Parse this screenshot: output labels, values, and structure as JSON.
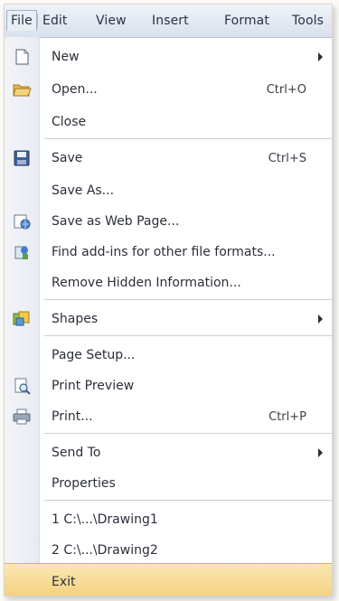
{
  "menubar": {
    "items": [
      {
        "label": "File"
      },
      {
        "label": "Edit"
      },
      {
        "label": "View"
      },
      {
        "label": "Insert"
      },
      {
        "label": "Format"
      },
      {
        "label": "Tools"
      }
    ]
  },
  "file_menu": {
    "items": [
      {
        "label": "New",
        "shortcut": "",
        "submenu": true,
        "icon": "new-document-icon"
      },
      {
        "label": "Open...",
        "shortcut": "Ctrl+O",
        "submenu": false,
        "icon": "open-folder-icon"
      },
      {
        "label": "Close",
        "shortcut": "",
        "submenu": false,
        "icon": ""
      },
      {
        "label": "Save",
        "shortcut": "Ctrl+S",
        "submenu": false,
        "icon": "save-disk-icon"
      },
      {
        "label": "Save As...",
        "shortcut": "",
        "submenu": false,
        "icon": ""
      },
      {
        "label": "Save as Web Page...",
        "shortcut": "",
        "submenu": false,
        "icon": "web-page-icon"
      },
      {
        "label": "Find add-ins for other file formats...",
        "shortcut": "",
        "submenu": false,
        "icon": "add-ins-icon"
      },
      {
        "label": "Remove Hidden Information...",
        "shortcut": "",
        "submenu": false,
        "icon": ""
      },
      {
        "label": "Shapes",
        "shortcut": "",
        "submenu": true,
        "icon": "shapes-icon"
      },
      {
        "label": "Page Setup...",
        "shortcut": "",
        "submenu": false,
        "icon": ""
      },
      {
        "label": "Print Preview",
        "shortcut": "",
        "submenu": false,
        "icon": "print-preview-icon"
      },
      {
        "label": "Print...",
        "shortcut": "Ctrl+P",
        "submenu": false,
        "icon": "printer-icon"
      },
      {
        "label": "Send To",
        "shortcut": "",
        "submenu": true,
        "icon": ""
      },
      {
        "label": "Properties",
        "shortcut": "",
        "submenu": false,
        "icon": ""
      },
      {
        "label": "1 C:\\...\\Drawing1",
        "shortcut": "",
        "submenu": false,
        "icon": ""
      },
      {
        "label": "2 C:\\...\\Drawing2",
        "shortcut": "",
        "submenu": false,
        "icon": ""
      },
      {
        "label": "Exit",
        "shortcut": "",
        "submenu": false,
        "icon": "",
        "highlighted": true
      }
    ]
  },
  "colors": {
    "menubar": "#dfe6f0",
    "highlight": "#f6d98f",
    "text": "#2b2f3a"
  }
}
